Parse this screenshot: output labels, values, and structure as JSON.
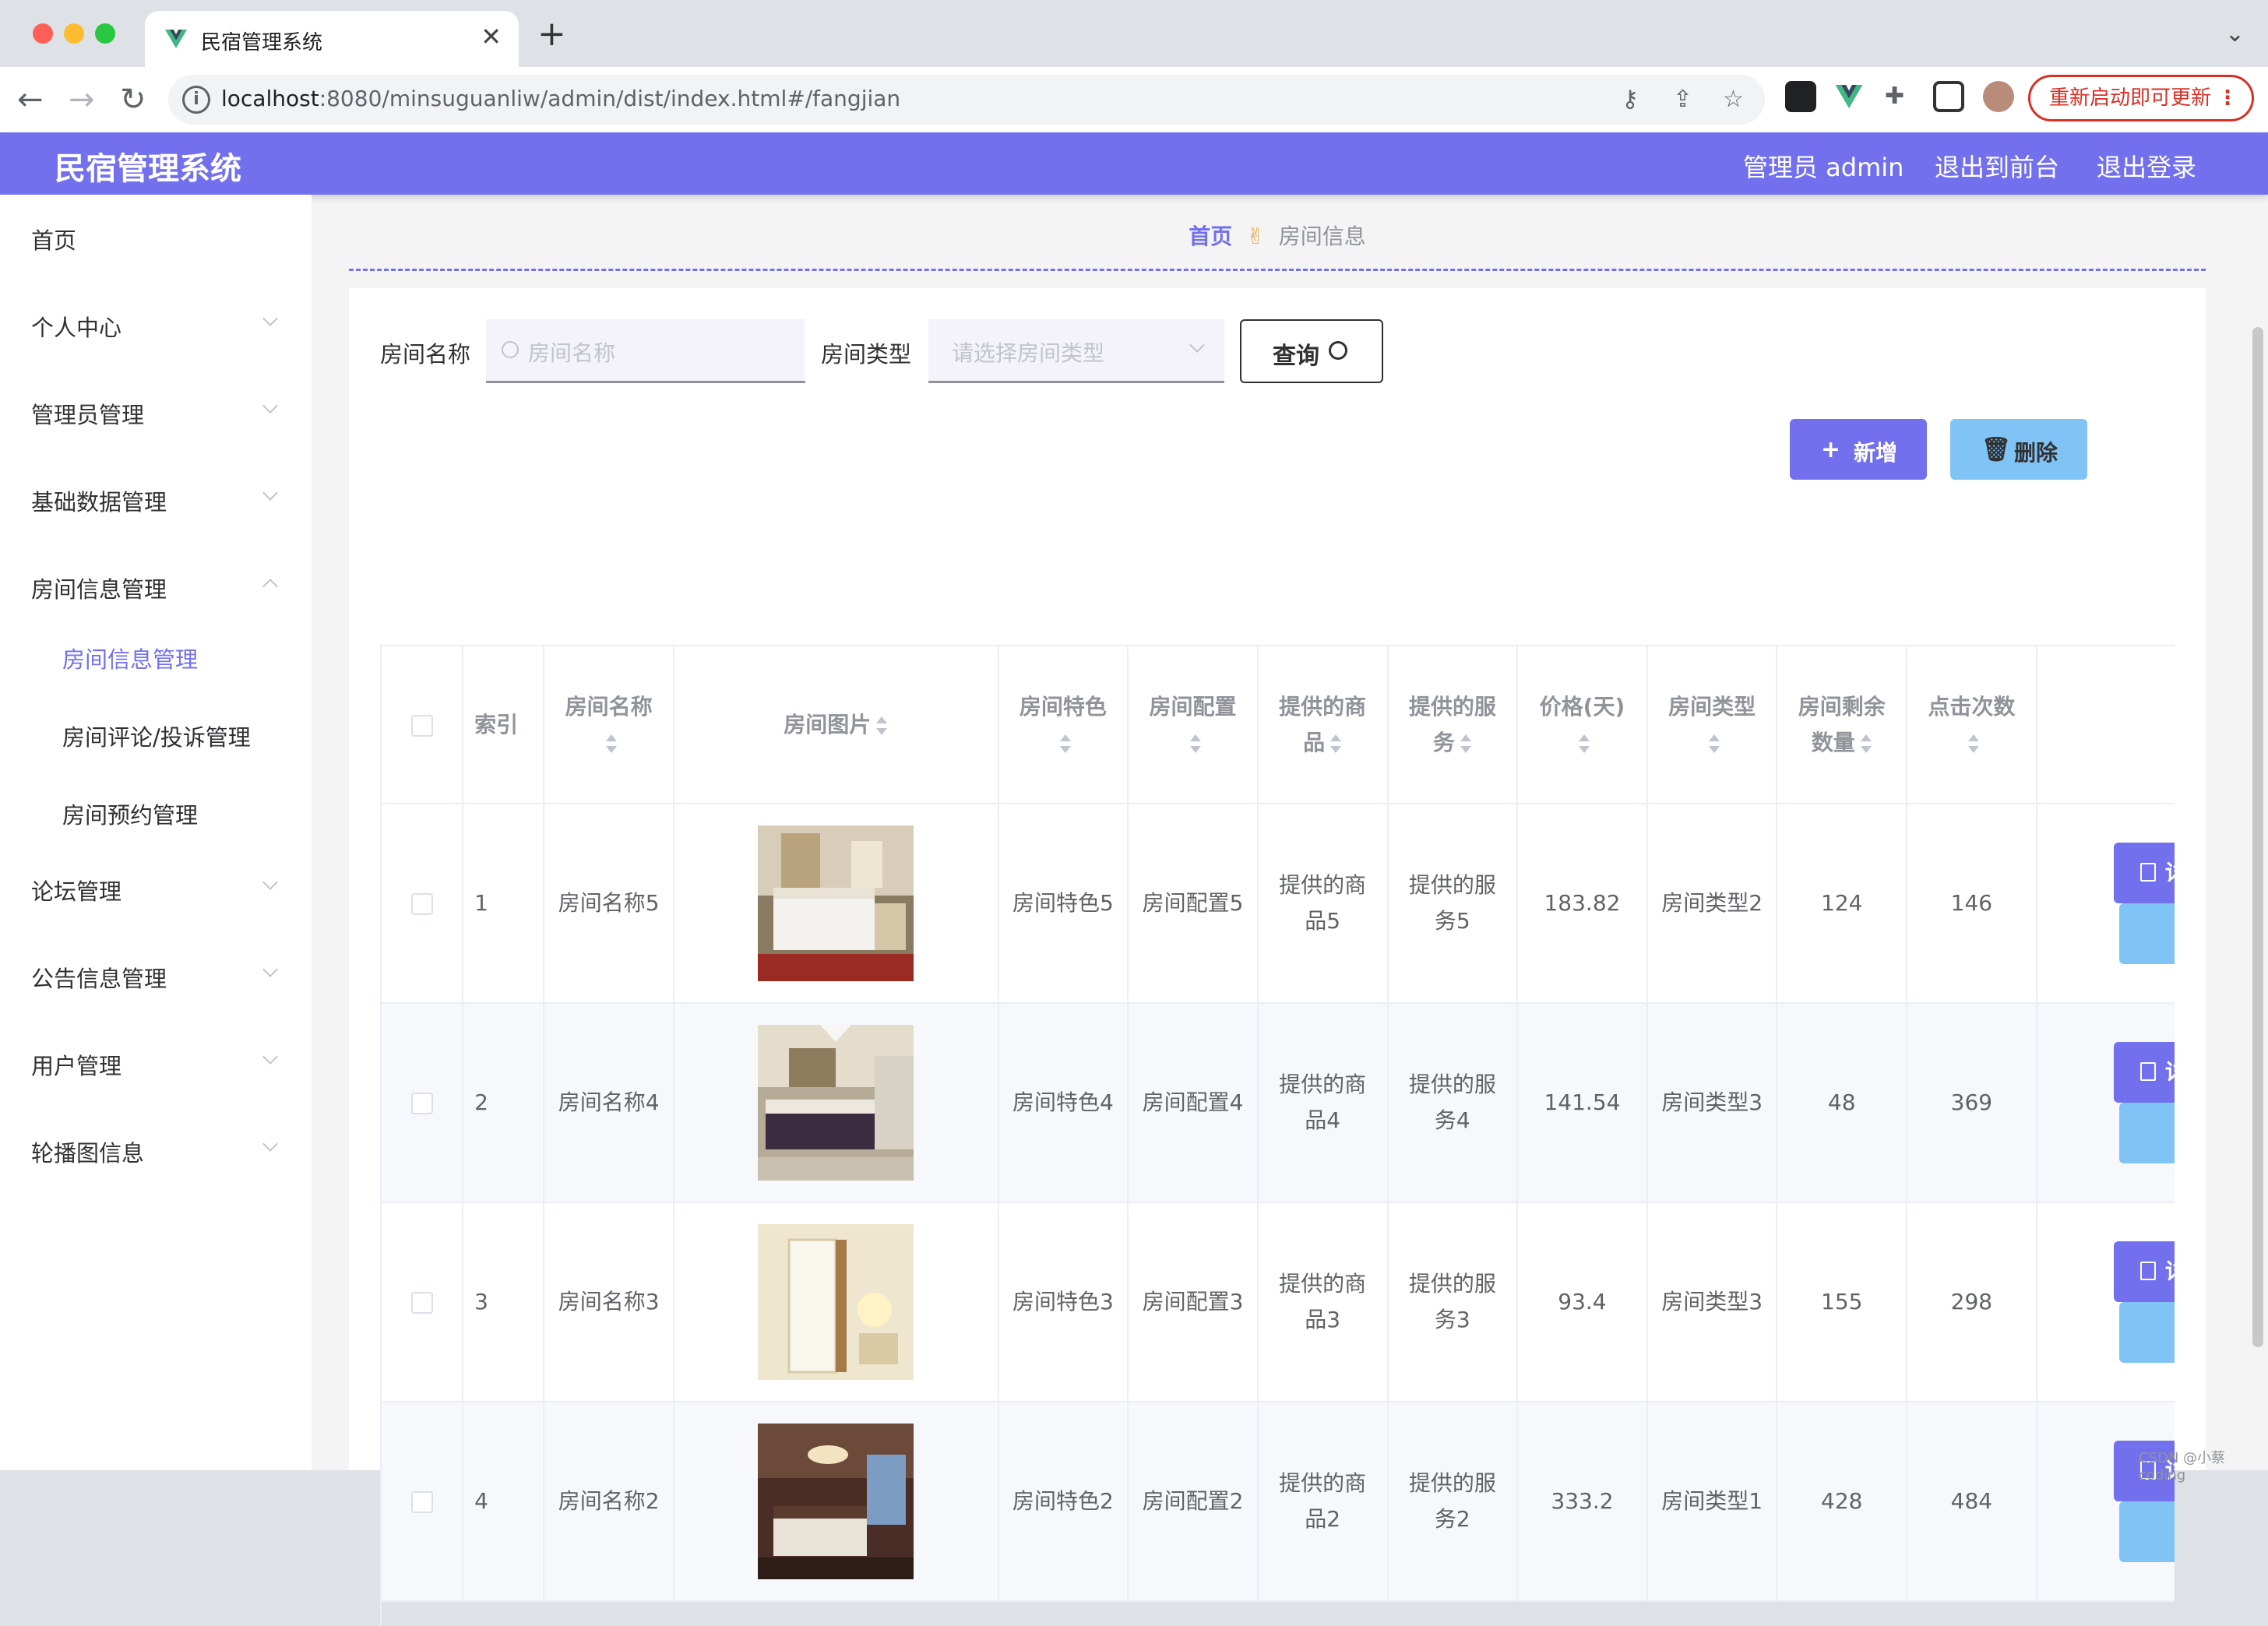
{
  "browser": {
    "tab_title": "民宿管理系统",
    "tab_close": "✕",
    "new_tab": "+",
    "url_host": "localhost",
    "url_path": ":8080/minsuguanliw/admin/dist/index.html#/fangjian",
    "update_button": "重新启动即可更新",
    "update_menu": "⋮"
  },
  "header": {
    "brand": "民宿管理系统",
    "user": "管理员 admin",
    "front_link": "退出到前台",
    "logout": "退出登录"
  },
  "sidebar": {
    "items": [
      {
        "label": "首页"
      },
      {
        "label": "个人中心"
      },
      {
        "label": "管理员管理"
      },
      {
        "label": "基础数据管理"
      },
      {
        "label": "房间信息管理"
      },
      {
        "label": "论坛管理"
      },
      {
        "label": "公告信息管理"
      },
      {
        "label": "用户管理"
      },
      {
        "label": "轮播图信息"
      }
    ],
    "sub_items": [
      {
        "label": "房间信息管理"
      },
      {
        "label": "房间评论/投诉管理"
      },
      {
        "label": "房间预约管理"
      }
    ]
  },
  "breadcrumb": {
    "home": "首页",
    "sep": "✌",
    "current": "房间信息"
  },
  "filters": {
    "name_label": "房间名称",
    "name_placeholder": "房间名称",
    "type_label": "房间类型",
    "type_placeholder": "请选择房间类型",
    "query_button": "查询"
  },
  "actions": {
    "add": "新增",
    "delete": "删除",
    "add_icon": "+",
    "delete_icon": "🗑"
  },
  "table": {
    "columns": [
      "索引",
      "房间名称",
      "房间图片",
      "房间特色",
      "房间配置",
      "提供的商品",
      "提供的服务",
      "价格(天)",
      "房间类型",
      "房间剩余数量",
      "点击次数"
    ],
    "detail_label": "详情",
    "rows": [
      {
        "index": "1",
        "name": "房间名称5",
        "feature": "房间特色5",
        "config": "房间配置5",
        "goods": "提供的商品5",
        "service": "提供的服务5",
        "price": "183.82",
        "type": "房间类型2",
        "remaining": "124",
        "clicks": "146"
      },
      {
        "index": "2",
        "name": "房间名称4",
        "feature": "房间特色4",
        "config": "房间配置4",
        "goods": "提供的商品4",
        "service": "提供的服务4",
        "price": "141.54",
        "type": "房间类型3",
        "remaining": "48",
        "clicks": "369"
      },
      {
        "index": "3",
        "name": "房间名称3",
        "feature": "房间特色3",
        "config": "房间配置3",
        "goods": "提供的商品3",
        "service": "提供的服务3",
        "price": "93.4",
        "type": "房间类型3",
        "remaining": "155",
        "clicks": "298"
      },
      {
        "index": "4",
        "name": "房间名称2",
        "feature": "房间特色2",
        "config": "房间配置2",
        "goods": "提供的商品2",
        "service": "提供的服务2",
        "price": "333.2",
        "type": "房间类型1",
        "remaining": "428",
        "clicks": "484"
      }
    ]
  },
  "watermark": "CSDN @小蔡coding",
  "colors": {
    "accent": "#7370ee",
    "light_blue": "#80c4f5",
    "update_red": "#d93025"
  }
}
